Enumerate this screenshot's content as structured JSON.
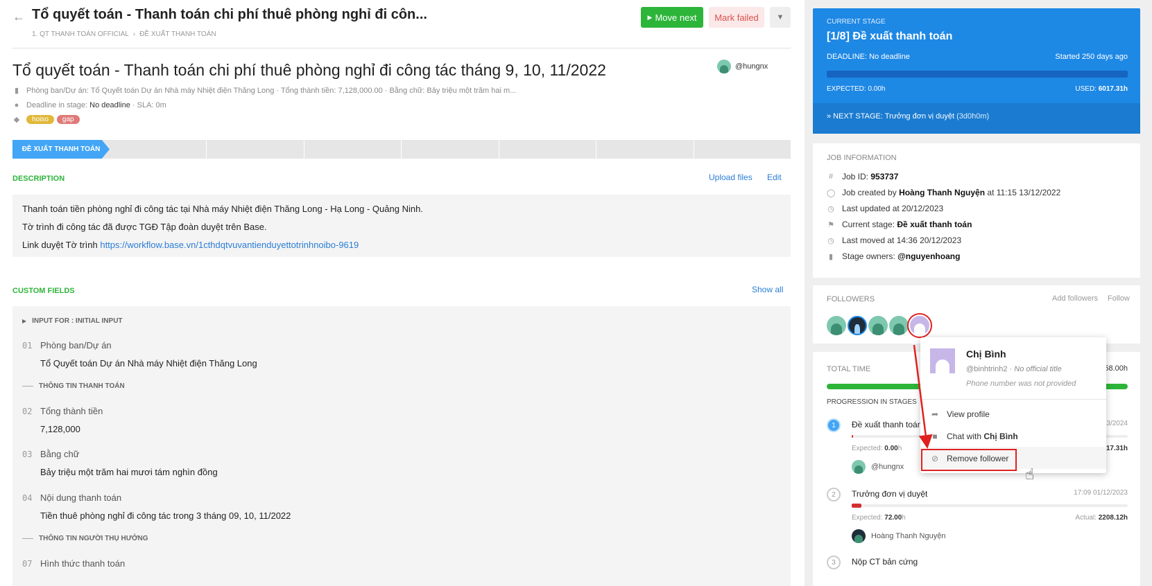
{
  "header": {
    "title": "Tổ quyết toán - Thanh toán chi phí thuê phòng nghỉ đi côn...",
    "breadcrumb": [
      "1. QT THANH TOÁN OFFICIAL",
      "ĐỀ XUẤT THANH TOÁN"
    ],
    "move_next": "Move next",
    "mark_failed": "Mark failed"
  },
  "job": {
    "title": "Tổ quyết toán - Thanh toán chi phí thuê phòng nghỉ đi công tác tháng 9, 10, 11/2022",
    "owner": "@hungnx",
    "meta": "Phòng ban/Dự án: Tổ Quyết toán Dự án Nhà máy Nhiệt điện Thăng Long · Tổng thành tiền: 7,128,000.00 · Bằng chữ: Bảy triệu một trăm hai m...",
    "deadline_label": "Deadline in stage:",
    "deadline_value": "No deadline",
    "sla": "· SLA: 0m",
    "tags": [
      {
        "label": "hoiso",
        "color": "#e0b83a"
      },
      {
        "label": "gap",
        "color": "#e07a7a"
      }
    ],
    "active_stage": "ĐỀ XUẤT THANH TOÁN"
  },
  "description": {
    "label": "DESCRIPTION",
    "upload": "Upload files",
    "edit": "Edit",
    "line1": "Thanh toán tiền phòng nghỉ đi công tác tại Nhà máy Nhiệt điện Thăng Long - Hạ Long - Quảng Ninh.",
    "line2": "Tờ trình đi công tác đã được TGĐ Tập đoàn duyệt trên Base.",
    "line3_prefix": "Link duyệt Tờ trình ",
    "link": "https://workflow.base.vn/1cthdqtvuvantienduyettotrinhnoibo-9619"
  },
  "custom_fields": {
    "label": "CUSTOM FIELDS",
    "show_all": "Show all",
    "group_input": "INPUT FOR : INITIAL INPUT",
    "group_payment": "THÔNG TIN THANH TOÁN",
    "group_beneficiary": "THÔNG TIN NGƯỜI THỤ HƯỞNG",
    "fields": [
      {
        "num": "01",
        "label": "Phòng ban/Dự án",
        "value": "Tổ Quyết toán Dự án Nhà máy Nhiệt điện Thăng Long"
      },
      {
        "num": "02",
        "label": "Tổng thành tiền",
        "value": "7,128,000"
      },
      {
        "num": "03",
        "label": "Bằng chữ",
        "value": "Bảy triệu một trăm hai mươi tám nghìn đồng"
      },
      {
        "num": "04",
        "label": "Nội dung thanh toán",
        "value": "Tiền thuê phòng nghỉ đi công tác trong 3 tháng 09, 10, 11/2022"
      },
      {
        "num": "07",
        "label": "Hình thức thanh toán",
        "value": ""
      }
    ]
  },
  "current_stage": {
    "label": "CURRENT STAGE",
    "name": "[1/8] Đề xuất thanh toán",
    "deadline_label": "DEADLINE:",
    "deadline_value": "No deadline",
    "started": "Started 250 days ago",
    "expected": "EXPECTED: 0.00h",
    "used_label": "USED:",
    "used_value": "6017.31h",
    "next_label": "» NEXT STAGE:",
    "next_value": "Trưởng đơn vị duyệt",
    "next_time": "(3d0h0m)"
  },
  "job_info": {
    "label": "JOB INFORMATION",
    "job_id_label": "Job ID:",
    "job_id": "953737",
    "created_prefix": "Job created by",
    "created_by": "Hoàng Thanh Nguyện",
    "created_at": "at 11:15 13/12/2022",
    "updated": "Last updated at 20/12/2023",
    "stage_label": "Current stage:",
    "stage_value": "Đề xuất thanh toán",
    "moved": "Last moved at 14:36 20/12/2023",
    "owners_label": "Stage owners:",
    "owners_value": "@nguyenhoang"
  },
  "followers": {
    "label": "FOLLOWERS",
    "add": "Add followers",
    "follow": "Follow"
  },
  "total_time": {
    "label": "TOTAL TIME",
    "value": "58.00h",
    "progression_label": "PROGRESSION IN STAGES",
    "steps": [
      {
        "num": "1",
        "name": "Đề xuất thanh toán",
        "date": "3/2024",
        "expected": "0.00",
        "actual": "17.31h",
        "user": "@hungnx",
        "fill": 0.005
      },
      {
        "num": "2",
        "name": "Trưởng đơn vị duyệt",
        "date": "17:09 01/12/2023",
        "expected": "72.00",
        "actual": "2208.12h",
        "user": "Hoàng Thanh Nguyện",
        "fill": 0.035
      },
      {
        "num": "3",
        "name": "Nộp CT bản cứng",
        "date": "",
        "expected": "",
        "actual": "",
        "user": "",
        "fill": 0
      }
    ],
    "expected_label": "Expected:",
    "actual_label": "Actual:"
  },
  "popup": {
    "name": "Chị Bình",
    "handle": "@binhtrinh2",
    "title": "No official title",
    "phone": "Phone number was not provided",
    "view_profile": "View profile",
    "chat_prefix": "Chat with",
    "remove": "Remove follower"
  }
}
